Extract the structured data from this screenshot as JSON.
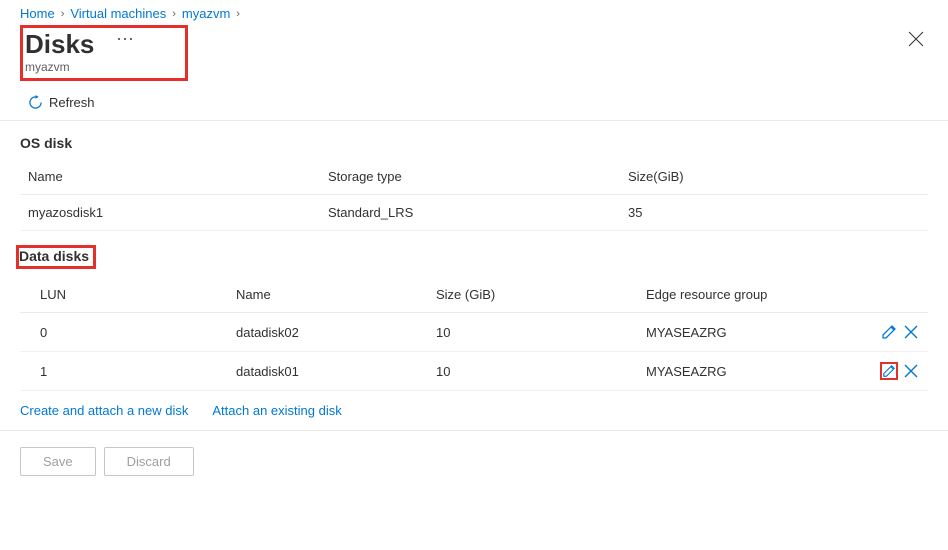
{
  "breadcrumb": {
    "items": [
      "Home",
      "Virtual machines",
      "myazvm"
    ]
  },
  "header": {
    "title": "Disks",
    "subtitle": "myazvm",
    "refresh": "Refresh"
  },
  "osDisk": {
    "label": "OS disk",
    "cols": {
      "name": "Name",
      "storage": "Storage type",
      "size": "Size(GiB)"
    },
    "rows": [
      {
        "name": "myazosdisk1",
        "storage": "Standard_LRS",
        "size": "35"
      }
    ]
  },
  "dataDisks": {
    "label": "Data disks",
    "cols": {
      "lun": "LUN",
      "name": "Name",
      "size": "Size (GiB)",
      "group": "Edge resource group"
    },
    "rows": [
      {
        "lun": "0",
        "name": "datadisk02",
        "size": "10",
        "group": "MYASEAZRG"
      },
      {
        "lun": "1",
        "name": "datadisk01",
        "size": "10",
        "group": "MYASEAZRG"
      }
    ]
  },
  "links": {
    "create": "Create and attach a new disk",
    "attach": "Attach an existing disk"
  },
  "footer": {
    "save": "Save",
    "discard": "Discard"
  }
}
